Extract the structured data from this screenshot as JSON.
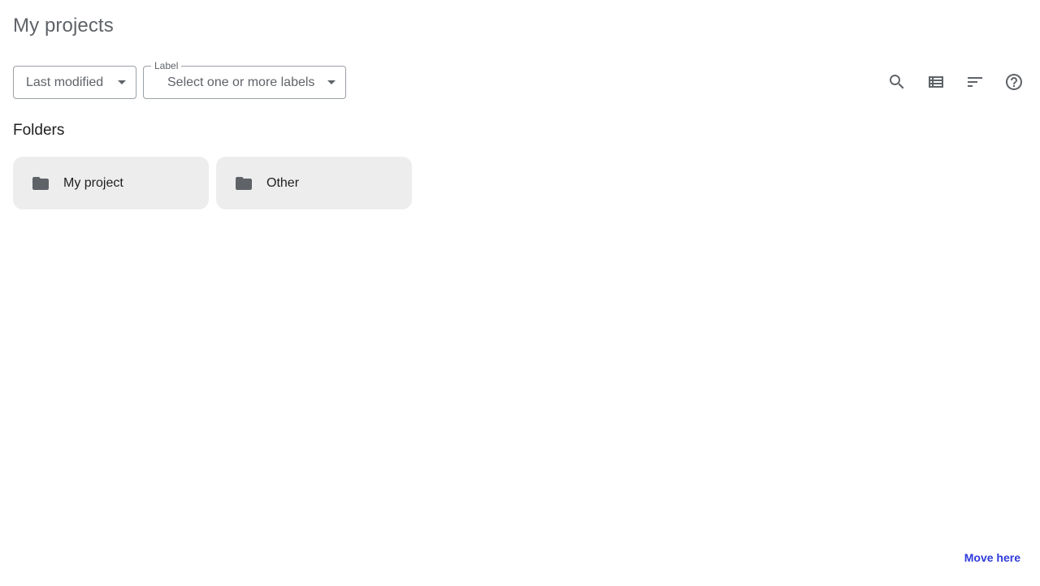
{
  "page": {
    "title": "My projects"
  },
  "filters": {
    "sort": {
      "value": "Last modified"
    },
    "label": {
      "floating_label": "Label",
      "placeholder": "Select one or more labels"
    }
  },
  "actions": {
    "icons": [
      "search-icon",
      "list-view-icon",
      "filter-sort-icon",
      "help-icon"
    ]
  },
  "folders_section": {
    "title": "Folders",
    "items": [
      {
        "name": "My project",
        "icon": "folder-icon"
      },
      {
        "name": "Other",
        "icon": "folder-icon"
      }
    ]
  },
  "footer": {
    "move_here_label": "Move here"
  },
  "colors": {
    "icon_gray": "#5f6368",
    "card_bg": "#ededed",
    "link_blue": "#2f3bdb"
  }
}
